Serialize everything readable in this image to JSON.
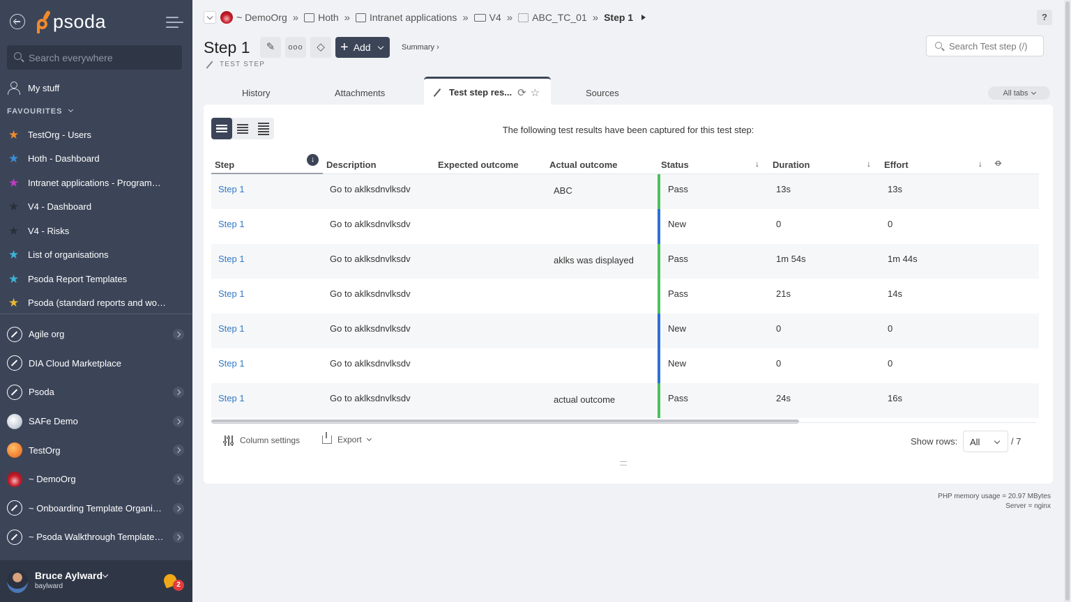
{
  "sidebar": {
    "logo_text": "psoda",
    "search_placeholder": "Search everywhere",
    "my_stuff": "My stuff",
    "favourites_heading": "FAVOURITES",
    "favourites": [
      {
        "label": "TestOrg - Users",
        "color": "#f08a2b"
      },
      {
        "label": "Hoth - Dashboard",
        "color": "#3b8ed8"
      },
      {
        "label": "Intranet applications - Programme...",
        "color": "#c23cc2"
      },
      {
        "label": "V4 - Dashboard",
        "color": "#2a2f3a"
      },
      {
        "label": "V4 - Risks",
        "color": "#2a2f3a"
      },
      {
        "label": "List of organisations",
        "color": "#3bb4d8"
      },
      {
        "label": "Psoda Report Templates",
        "color": "#3bb4d8"
      },
      {
        "label": "Psoda (standard reports and work...",
        "color": "#e8b830"
      }
    ],
    "orgs": [
      {
        "label": "Agile org",
        "icon": "pen",
        "chevron": true
      },
      {
        "label": "DIA Cloud Marketplace",
        "icon": "pen",
        "chevron": false
      },
      {
        "label": "Psoda",
        "icon": "pen",
        "chevron": true
      },
      {
        "label": "SAFe Demo",
        "icon": "safe",
        "chevron": true
      },
      {
        "label": "TestOrg",
        "icon": "testorg",
        "chevron": true
      },
      {
        "label": "~ DemoOrg",
        "icon": "demo",
        "chevron": true
      },
      {
        "label": "~ Onboarding Template Organisa...",
        "icon": "pen",
        "chevron": true
      },
      {
        "label": "~ Psoda Walkthrough Template P...",
        "icon": "pen",
        "chevron": true
      }
    ],
    "user": {
      "name": "Bruce Aylward",
      "login": "baylward",
      "notifications": "2"
    }
  },
  "breadcrumbs": [
    {
      "label": "~ DemoOrg",
      "icon": "org"
    },
    {
      "label": "Hoth",
      "icon": "book"
    },
    {
      "label": "Intranet applications",
      "icon": "book"
    },
    {
      "label": "V4",
      "icon": "folder"
    },
    {
      "label": "ABC_TC_01",
      "icon": "testcase"
    },
    {
      "label": "Step 1",
      "icon": "none"
    }
  ],
  "header": {
    "title": "Step 1",
    "subtitle": "TEST STEP",
    "add_label": "Add",
    "summary_link": "Summary ›",
    "search_placeholder": "Search Test step (/)",
    "help": "?"
  },
  "tabs": {
    "history": "History",
    "attachments": "Attachments",
    "active": "Test step res...",
    "sources": "Sources",
    "all_tabs": "All tabs"
  },
  "panel": {
    "caption": "The following test results have been captured for this test step:",
    "columns": [
      "Step",
      "Description",
      "Expected outcome",
      "Actual outcome",
      "Status",
      "Duration",
      "Effort"
    ],
    "rows": [
      {
        "step": "Step 1",
        "description": "Go to aklksdnvlksdv",
        "expected": "",
        "actual": "ABC",
        "status": "Pass",
        "duration": "13s",
        "effort": "13s"
      },
      {
        "step": "Step 1",
        "description": "Go to aklksdnvlksdv",
        "expected": "",
        "actual": "",
        "status": "New",
        "duration": "0",
        "effort": "0"
      },
      {
        "step": "Step 1",
        "description": "Go to aklksdnvlksdv",
        "expected": "",
        "actual": "aklks was displayed",
        "status": "Pass",
        "duration": "1m 54s",
        "effort": "1m 44s"
      },
      {
        "step": "Step 1",
        "description": "Go to aklksdnvlksdv",
        "expected": "",
        "actual": "",
        "status": "Pass",
        "duration": "21s",
        "effort": "14s"
      },
      {
        "step": "Step 1",
        "description": "Go to aklksdnvlksdv",
        "expected": "",
        "actual": "",
        "status": "New",
        "duration": "0",
        "effort": "0"
      },
      {
        "step": "Step 1",
        "description": "Go to aklksdnvlksdv",
        "expected": "",
        "actual": "",
        "status": "New",
        "duration": "0",
        "effort": "0"
      },
      {
        "step": "Step 1",
        "description": "Go to aklksdnvlksdv",
        "expected": "",
        "actual": "actual outcome",
        "status": "Pass",
        "duration": "24s",
        "effort": "16s"
      }
    ],
    "status_colors": {
      "Pass": "#4cc35a",
      "New": "#2f6fd6"
    },
    "column_settings": "Column settings",
    "export": "Export",
    "show_rows_label": "Show rows:",
    "show_rows_value": "All",
    "rows_total": "/ 7"
  },
  "footer": {
    "memory": "PHP memory usage = 20.97 MBytes",
    "server": "Server = nginx"
  }
}
